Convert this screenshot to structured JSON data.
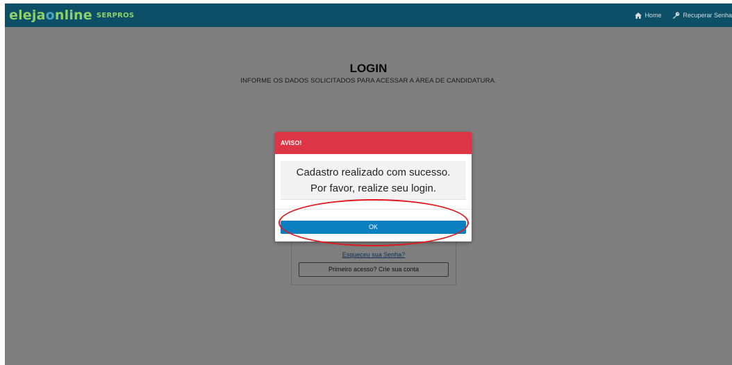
{
  "navbar": {
    "brand_main_1": "eleja",
    "brand_main_o": "o",
    "brand_main_2": "nline",
    "brand_sub": "SERPROS",
    "links": [
      {
        "label": "Home",
        "icon": "home-icon"
      },
      {
        "label": "Recuperar Senha",
        "icon": "key-icon"
      }
    ]
  },
  "page": {
    "title": "LOGIN",
    "subtitle": "INFORME OS DADOS SOLICITADOS PARA ACESSAR A ÁREA DE CANDIDATURA.",
    "forgot_link": "Esqueceu sua Senha?",
    "first_access_button": "Primeiro acesso? Crie sua conta"
  },
  "modal": {
    "title": "AVISO!",
    "message_line1": "Cadastro realizado com sucesso.",
    "message_line2": "Por favor, realize seu login.",
    "ok_button": "OK",
    "header_color": "#dc3545",
    "button_color": "#0b7fbf"
  },
  "annotation": {
    "shape": "ellipse",
    "color": "#e0191f"
  }
}
